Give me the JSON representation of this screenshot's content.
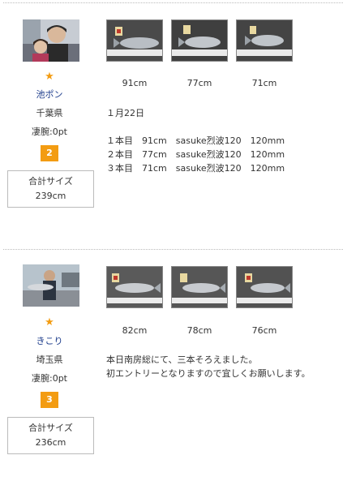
{
  "entries": [
    {
      "user_name": "池ポン",
      "prefecture": "千葉県",
      "skill": "凄腕:0pt",
      "rank": "2",
      "total_size_label": "合計サイズ",
      "total_size_value": "239cm",
      "photo_captions": [
        "91cm",
        "77cm",
        "71cm"
      ],
      "comment_lines": [
        "１月22日",
        "",
        "１本目　91cm　sasuke烈波120　120mm",
        "２本目　77cm　sasuke烈波120　120mm",
        "３本目　71cm　sasuke烈波120　120mm"
      ]
    },
    {
      "user_name": "きこり",
      "prefecture": "埼玉県",
      "skill": "凄腕:0pt",
      "rank": "3",
      "total_size_label": "合計サイズ",
      "total_size_value": "236cm",
      "photo_captions": [
        "82cm",
        "78cm",
        "76cm"
      ],
      "comment_lines": [
        "本日南房総にて、三本そろえました。",
        "初エントリーとなりますので宜しくお願いします。"
      ]
    }
  ],
  "icons": {
    "star": "star-icon",
    "star_color": "#f39c12",
    "rank_badge_color": "#f39c12",
    "user_name_color": "#1a3a8a"
  }
}
